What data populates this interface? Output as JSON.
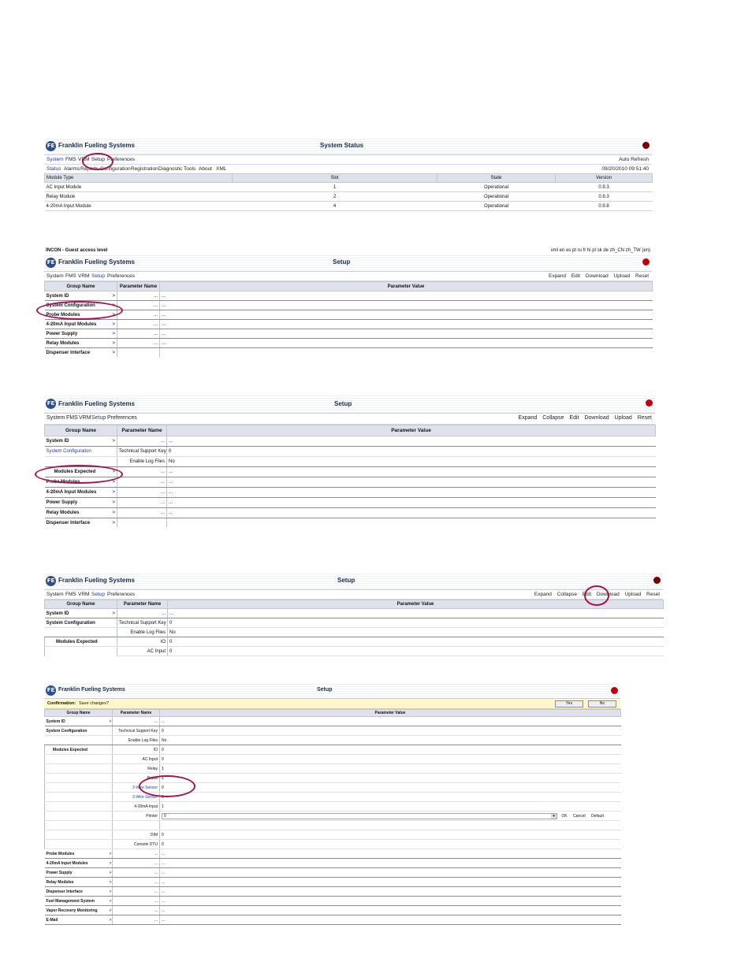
{
  "brand": "Franklin Fueling Systems",
  "logo_letter": "FE",
  "colors": {
    "accent_blue": "#1f3ba8",
    "brand_navy": "#1b2a4a",
    "alert_red": "#c0000a",
    "annotation": "#a4124f"
  },
  "shot1": {
    "title": "System Status",
    "menu": [
      "System",
      "FMS",
      "VRM",
      "Setup",
      "Preferences"
    ],
    "submenu": [
      "Status",
      "Alarms",
      "Reports",
      "Configuration",
      "Registration",
      "Diagnostic",
      "Tools",
      "About",
      "XML"
    ],
    "auto_refresh": "Auto Refresh",
    "timestamp": "09/20/2010 09:51:40",
    "columns": [
      "Module Type",
      "Slot",
      "State",
      "Version"
    ],
    "rows": [
      [
        "AC Input Module",
        "1",
        "Operational",
        "0.9.3"
      ],
      [
        "Relay Module",
        "2",
        "Operational",
        "0.9.3"
      ],
      [
        "4-20mA Input Module",
        "4",
        "Operational",
        "0.9.8"
      ]
    ]
  },
  "shot2": {
    "access": "INCON - Guest access level",
    "languages": "xml en es pt ru fr hi pl sk de zh_CN zh_TW (en)",
    "title": "Setup",
    "menu": [
      "System",
      "FMS",
      "VRM",
      "Setup",
      "Preferences"
    ],
    "tools": [
      "Expand",
      "Edit",
      "Download",
      "Upload",
      "Reset"
    ],
    "columns": [
      "Group Name",
      "Parameter Name",
      "Parameter Value"
    ],
    "groups": [
      "System ID",
      "System Configuration",
      "Probe Modules",
      "4-20mA Input Modules",
      "Power Supply",
      "Relay Modules",
      "Dispenser Interface"
    ],
    "arrow": ">",
    "ellipsis": "..."
  },
  "shot3": {
    "title": "Setup",
    "menu": [
      "System",
      "FMS",
      "VRM",
      "Setup",
      "Preferences"
    ],
    "tools": [
      "Expand",
      "Collapse",
      "Edit",
      "Download",
      "Upload",
      "Reset"
    ],
    "columns": [
      "Group Name",
      "Parameter Name",
      "Parameter Value"
    ],
    "system_id": "System ID",
    "system_config": "System Configuration",
    "params": [
      [
        "Technical Support Key",
        "0"
      ],
      [
        "Enable Log Files",
        "No"
      ]
    ],
    "modules_expected": "Modules Expected",
    "groups_after": [
      "Probe Modules",
      "4-20mA Input Modules",
      "Power Supply",
      "Relay Modules",
      "Dispenser Interface"
    ]
  },
  "shot4": {
    "title": "Setup",
    "menu": [
      "System",
      "FMS",
      "VRM",
      "Setup",
      "Preferences"
    ],
    "tools": [
      "Expand",
      "Collapse",
      "Edit",
      "Download",
      "Upload",
      "Reset"
    ],
    "columns": [
      "Group Name",
      "Parameter Name",
      "Parameter Value"
    ],
    "system_id": "System ID",
    "system_config": "System Configuration",
    "params": [
      [
        "Technical Support Key",
        "0"
      ],
      [
        "Enable Log Files",
        "No"
      ]
    ],
    "modules_expected": "Modules Expected",
    "mod_params": [
      [
        "IO",
        "0"
      ],
      [
        "AC Input",
        "0"
      ]
    ]
  },
  "shot5": {
    "title": "Setup",
    "confirmation_label": "Confirmation:",
    "confirmation_text": "Save changes?",
    "yes": "Yes",
    "no": "No",
    "columns": [
      "Group Name",
      "Parameter Name",
      "Parameter Value"
    ],
    "system_id": "System ID",
    "system_config": "System Configuration",
    "params": [
      [
        "Technical Support Key",
        "0"
      ],
      [
        "Enable Log Files",
        "No"
      ]
    ],
    "modules_expected": "Modules Expected",
    "mod_params": [
      [
        "IO",
        "0"
      ],
      [
        "AC Input",
        "0"
      ],
      [
        "Relay",
        "1"
      ],
      [
        "Probe",
        "1"
      ],
      [
        "2-Wire Sensor",
        "0"
      ],
      [
        "3-Wire Sensor",
        "0"
      ],
      [
        "4-20mA Input",
        "1"
      ],
      [
        "Printer",
        "0"
      ],
      [
        "",
        ""
      ],
      [
        "DIM",
        "0"
      ],
      [
        "Console DTU",
        "0"
      ]
    ],
    "edit_actions": [
      "OK",
      "Cancel",
      "Default"
    ],
    "groups_after": [
      "Probe Modules",
      "4-20mA Input Modules",
      "Power Supply",
      "Relay Modules",
      "Dispenser Interface",
      "Fuel Management System",
      "Vapor Recovery Monitoring",
      "E-Mail"
    ]
  }
}
